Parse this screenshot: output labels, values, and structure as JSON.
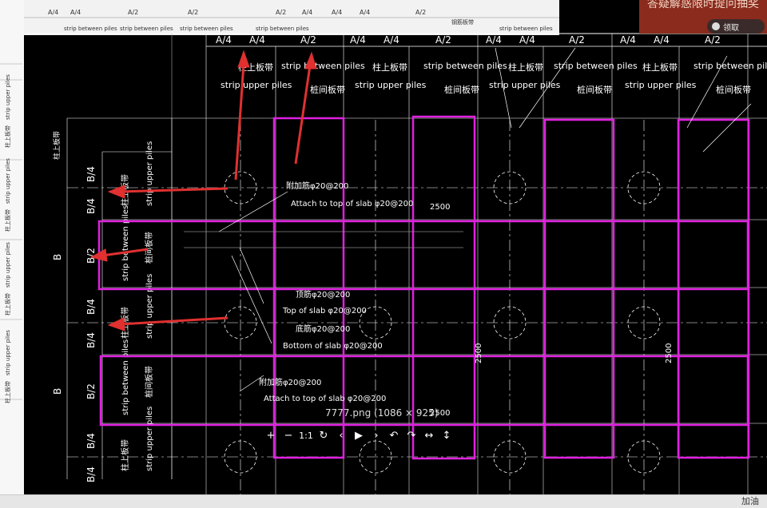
{
  "drawing": {
    "top_ruler_labels": [
      "A/4",
      "A/4",
      "A/4",
      "A/2",
      "A/2",
      "A/2",
      "A/4",
      "A/4",
      "A/4",
      "A/2"
    ],
    "top_ruler_small": [
      "strip between piles",
      "strip between piles",
      "strip between piles",
      "strip between piles",
      "钢筋板带",
      "strip between piles"
    ],
    "column_headers": [
      "A/4",
      "A/4",
      "A/2",
      "A/4",
      "A/4",
      "A/2",
      "A/4",
      "A/4",
      "A/2",
      "A/4",
      "A/4",
      "A/2"
    ],
    "strip_upper_piles": "strip upper piles",
    "strip_between_piles": "strip between piles",
    "upper_cn": "柱上板带",
    "between_cn": "桩间板带",
    "row_labels": [
      "B/4",
      "B/4",
      "B/2",
      "B/4",
      "B/4",
      "B/2",
      "B/4",
      "B/4"
    ],
    "row_big_labels": [
      "B",
      "B"
    ],
    "side_small_label": "柱上板带",
    "annotations": {
      "a1": "附加筋φ20@200",
      "a1_en": "Attach to top of slab φ20@200",
      "a2": "顶筋φ20@200",
      "a2_en": "Top of slab φ20@200",
      "a3": "底筋φ20@200",
      "a3_en": "Bottom of slab φ20@200",
      "a4": "附加筋φ20@200",
      "a4_en": "Attach to top of slab φ20@200",
      "dim1": "2500",
      "dim2": "2500",
      "dim3": "2500",
      "dim4": "2500"
    },
    "left_strip_labels": [
      "strip upper piles",
      "柱上板带",
      "strip upper piles",
      "柱上板带",
      "strip upper piles",
      "柱上板带",
      "strip upper piles",
      "柱上板带"
    ]
  },
  "viewer": {
    "caption": "7777.png (1086 × 925)",
    "toolbar": [
      "+",
      "−",
      "1:1",
      "↻",
      "‹",
      "▶",
      "›",
      "↶",
      "↷",
      "↔",
      "↕"
    ]
  },
  "ad": {
    "text": "答疑解惑限时提问抽奖",
    "button": "领取"
  },
  "statusbar": {
    "text": "加油"
  },
  "colors": {
    "magenta": "#e020e0",
    "red_arrow": "#e03030",
    "background": "#000000"
  }
}
